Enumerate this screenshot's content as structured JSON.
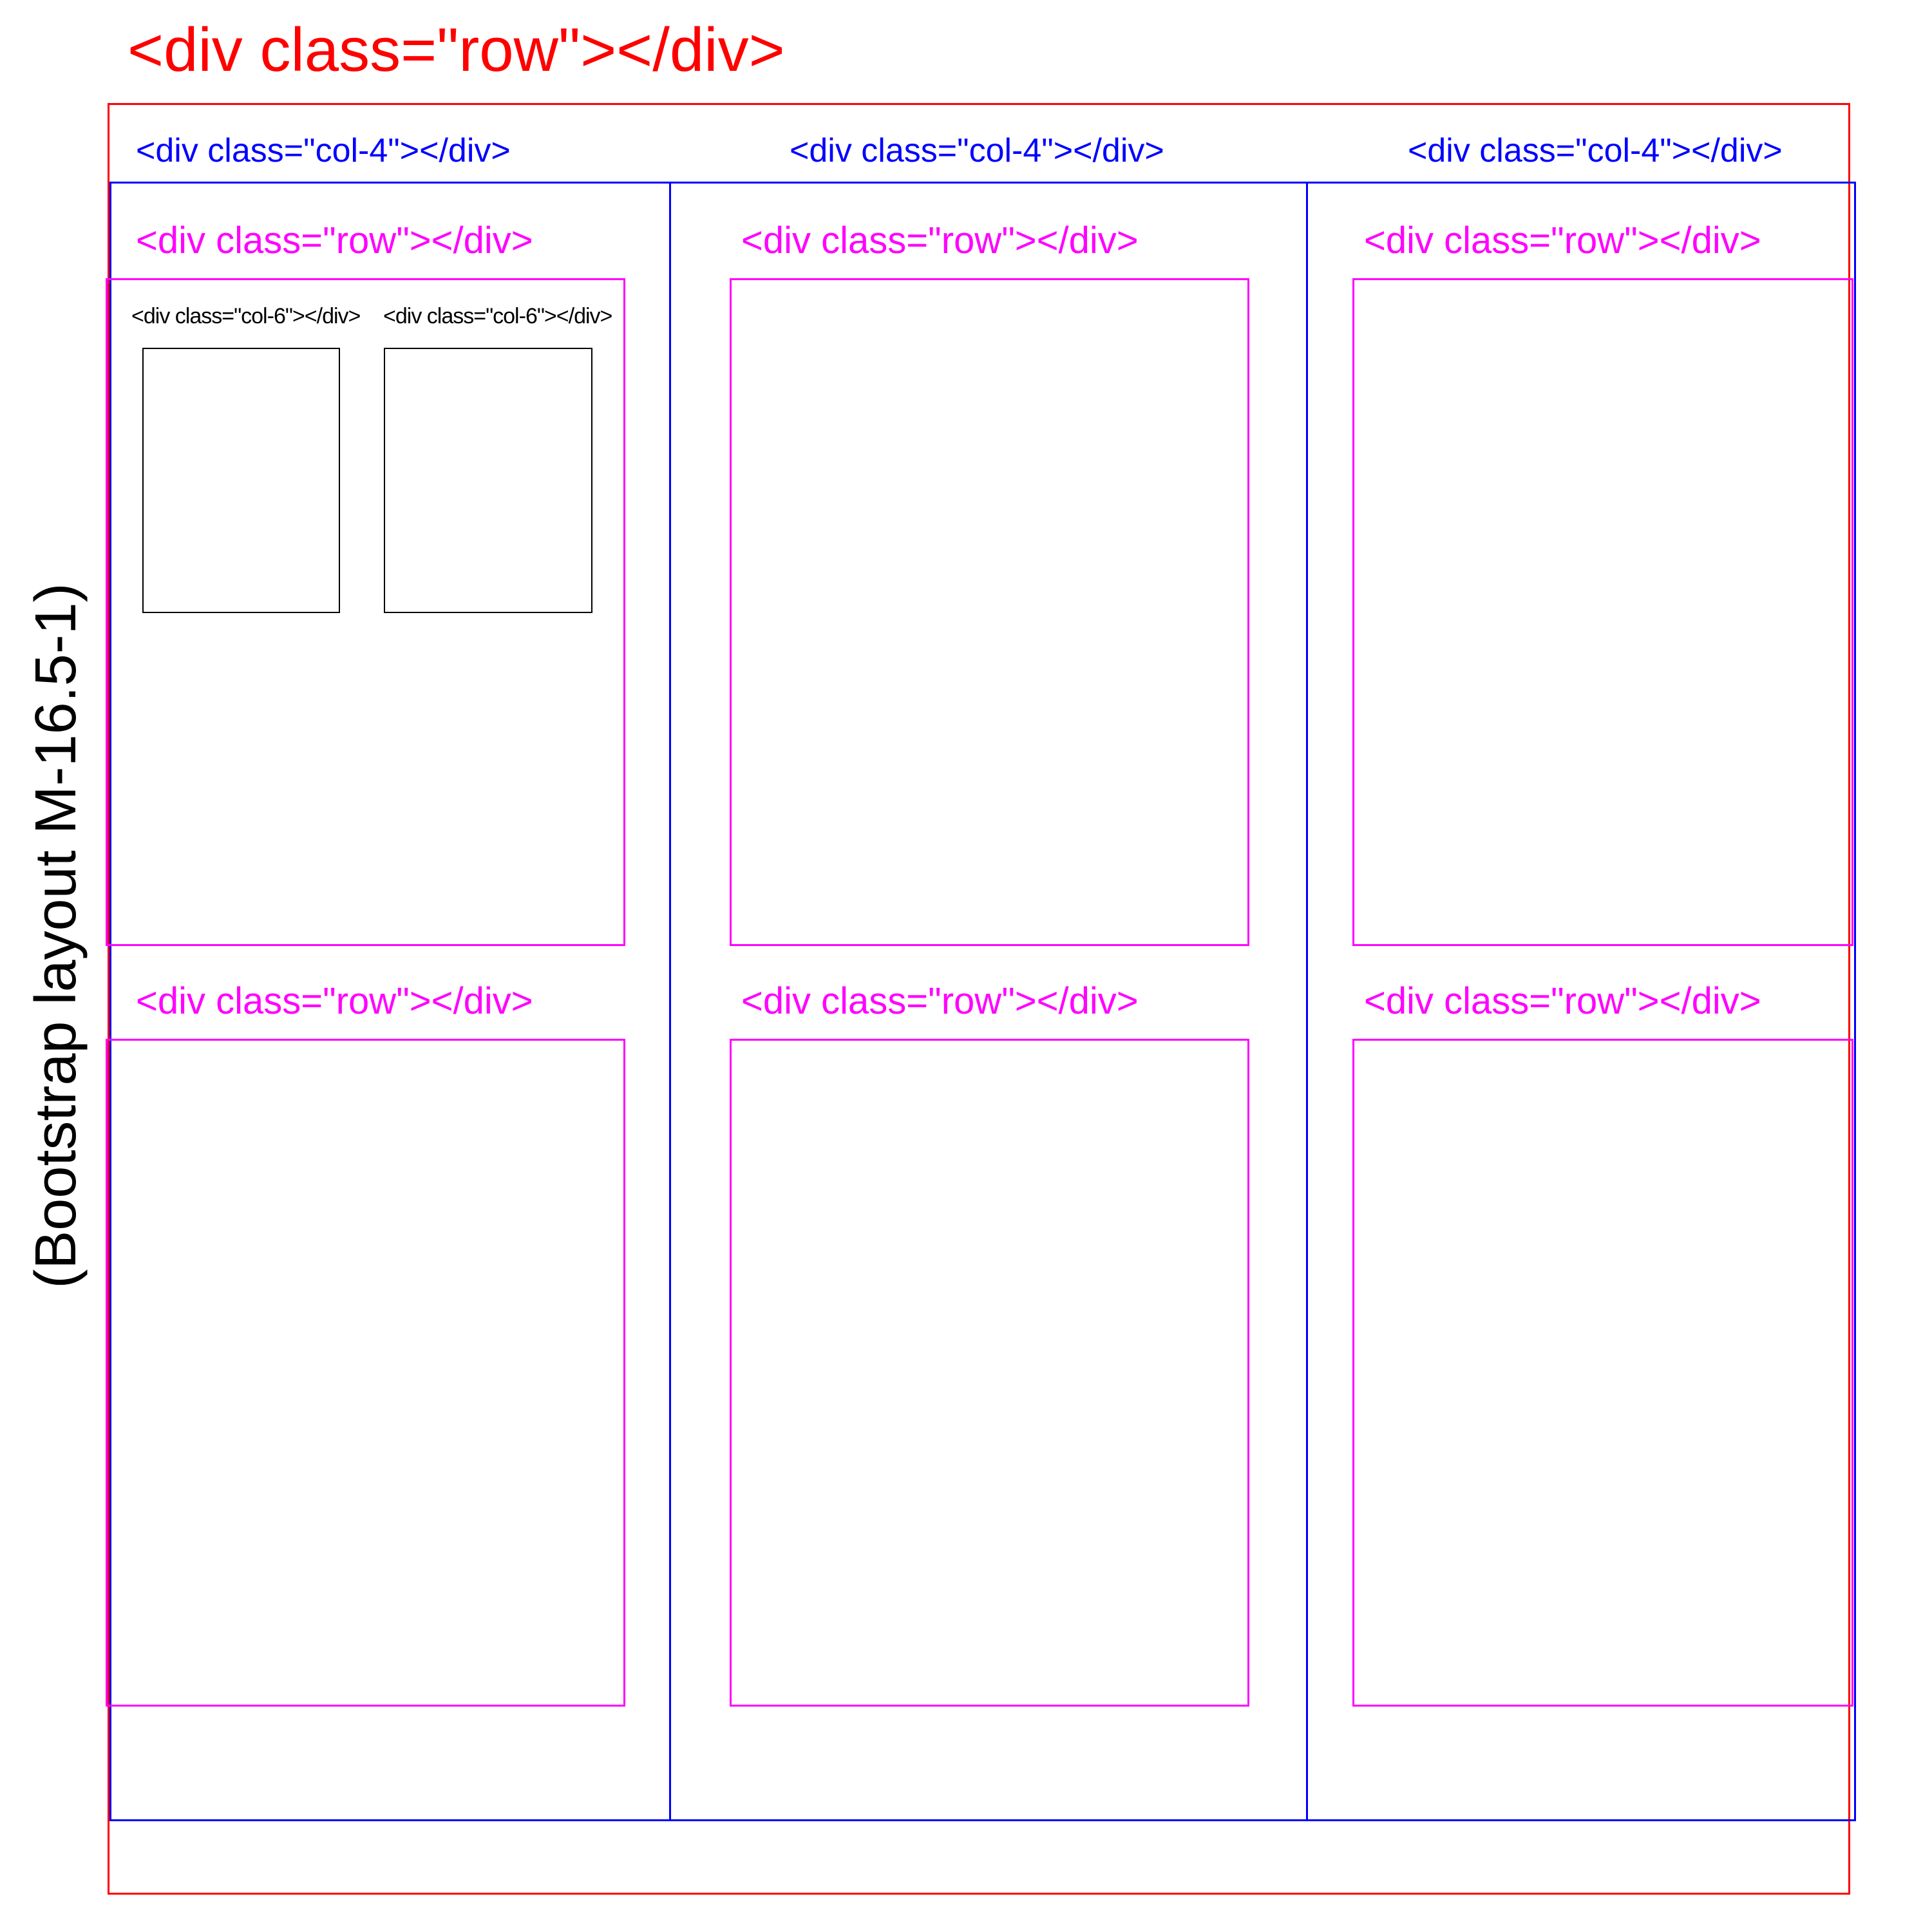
{
  "colors": {
    "outer": "#ff0000",
    "column": "#0000ff",
    "row": "#ff00ff",
    "subcol": "#000000"
  },
  "caption": "(Bootstrap layout M-16.5-1)",
  "outer": {
    "label": "<div class=\"row\"></div>"
  },
  "columns": [
    {
      "label": "<div class=\"col-4\"></div>"
    },
    {
      "label": "<div class=\"col-4\"></div>"
    },
    {
      "label": "<div class=\"col-4\"></div>"
    }
  ],
  "rows": [
    {
      "label": "<div class=\"row\"></div>"
    },
    {
      "label": "<div class=\"row\"></div>"
    },
    {
      "label": "<div class=\"row\"></div>"
    },
    {
      "label": "<div class=\"row\"></div>"
    },
    {
      "label": "<div class=\"row\"></div>"
    },
    {
      "label": "<div class=\"row\"></div>"
    }
  ],
  "subcols": [
    {
      "label": "<div class=\"col-6\"></div>"
    },
    {
      "label": "<div class=\"col-6\"></div>"
    }
  ]
}
